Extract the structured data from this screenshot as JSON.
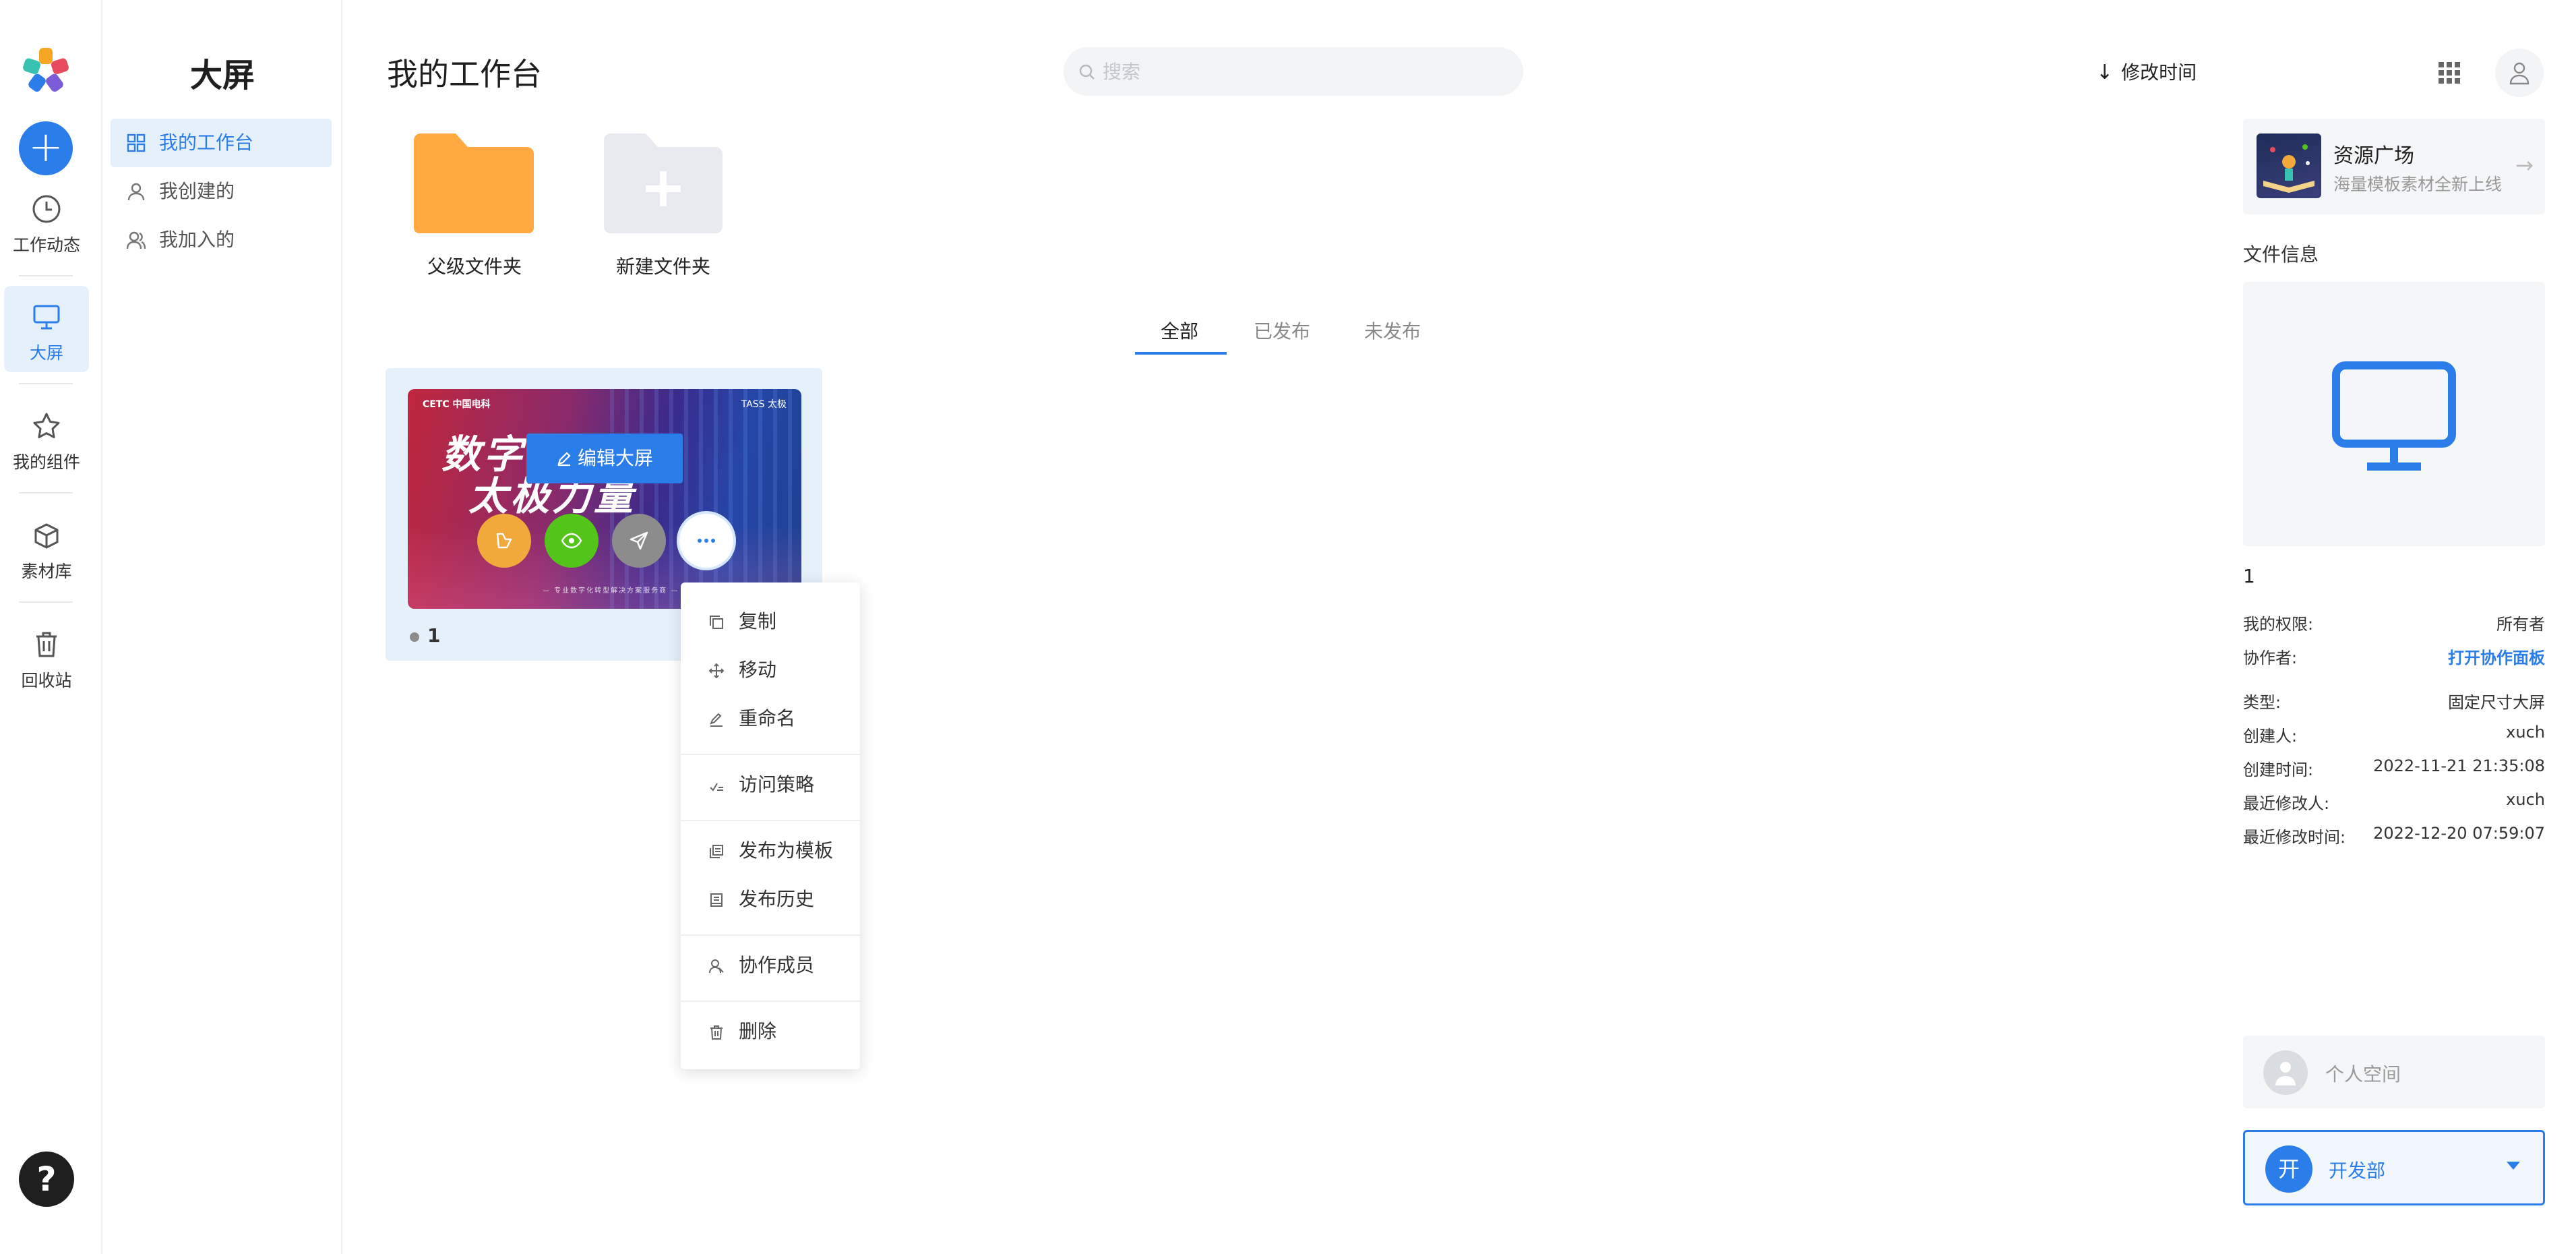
{
  "rail": {
    "add_label": "+",
    "items": [
      {
        "label": "工作动态",
        "icon": "clock-icon"
      },
      {
        "label": "大屏",
        "icon": "monitor-icon"
      },
      {
        "label": "我的组件",
        "icon": "star-icon"
      },
      {
        "label": "素材库",
        "icon": "box-icon"
      },
      {
        "label": "回收站",
        "icon": "trash-icon"
      }
    ],
    "help": "?"
  },
  "sidebar": {
    "title": "大屏",
    "items": [
      {
        "label": "我的工作台",
        "icon": "grid-icon"
      },
      {
        "label": "我创建的",
        "icon": "person-icon"
      },
      {
        "label": "我加入的",
        "icon": "people-icon"
      }
    ]
  },
  "header": {
    "title": "我的工作台",
    "search_placeholder": "搜索",
    "sort_label": "修改时间"
  },
  "folders": [
    {
      "label": "父级文件夹",
      "icon": "folder-icon"
    },
    {
      "label": "新建文件夹",
      "icon": "folder-add-icon"
    }
  ],
  "tabs": [
    {
      "label": "全部",
      "active": true
    },
    {
      "label": "已发布",
      "active": false
    },
    {
      "label": "未发布",
      "active": false
    }
  ],
  "card": {
    "name": "1",
    "edit_label": "编辑大屏",
    "thumb_brand": "CETC 中国电科",
    "thumb_brand_right": "TASS 太极",
    "thumb_line1": "数字中国",
    "thumb_line2": "太极力量",
    "thumb_sub": "— 专业数字化转型解决方案服务商 —",
    "actions": [
      {
        "icon": "share-icon",
        "color": "#f2a93b"
      },
      {
        "icon": "eye-icon",
        "color": "#52c41a"
      },
      {
        "icon": "send-icon",
        "color": "#8c8c8c"
      },
      {
        "icon": "more-icon",
        "color": "#ffffff"
      }
    ]
  },
  "context_menu": {
    "groups": [
      [
        {
          "label": "复制",
          "icon": "copy-icon"
        },
        {
          "label": "移动",
          "icon": "move-icon"
        },
        {
          "label": "重命名",
          "icon": "pencil-icon"
        }
      ],
      [
        {
          "label": "访问策略",
          "icon": "access-icon"
        }
      ],
      [
        {
          "label": "发布为模板",
          "icon": "template-icon"
        },
        {
          "label": "发布历史",
          "icon": "history-icon"
        }
      ],
      [
        {
          "label": "协作成员",
          "icon": "members-icon"
        }
      ],
      [
        {
          "label": "删除",
          "icon": "delete-icon"
        }
      ]
    ]
  },
  "right_panel": {
    "resource": {
      "title": "资源广场",
      "subtitle": "海量模板素材全新上线"
    },
    "file_info_title": "文件信息",
    "file_name": "1",
    "rows": [
      {
        "label": "我的权限:",
        "value": "所有者"
      },
      {
        "label": "协作者:",
        "value": "打开协作面板",
        "link": true
      },
      {
        "label": "类型:",
        "value": "固定尺寸大屏"
      },
      {
        "label": "创建人:",
        "value": "xuch"
      },
      {
        "label": "创建时间:",
        "value": "2022-11-21 21:35:08"
      },
      {
        "label": "最近修改人:",
        "value": "xuch"
      },
      {
        "label": "最近修改时间:",
        "value": "2022-12-20 07:59:07"
      }
    ],
    "personal_space": "个人空间",
    "department": {
      "avatar": "开",
      "name": "开发部"
    }
  },
  "colors": {
    "accent": "#2b7de9",
    "folder": "#ffa940",
    "active_bg": "#e6f0fb"
  }
}
